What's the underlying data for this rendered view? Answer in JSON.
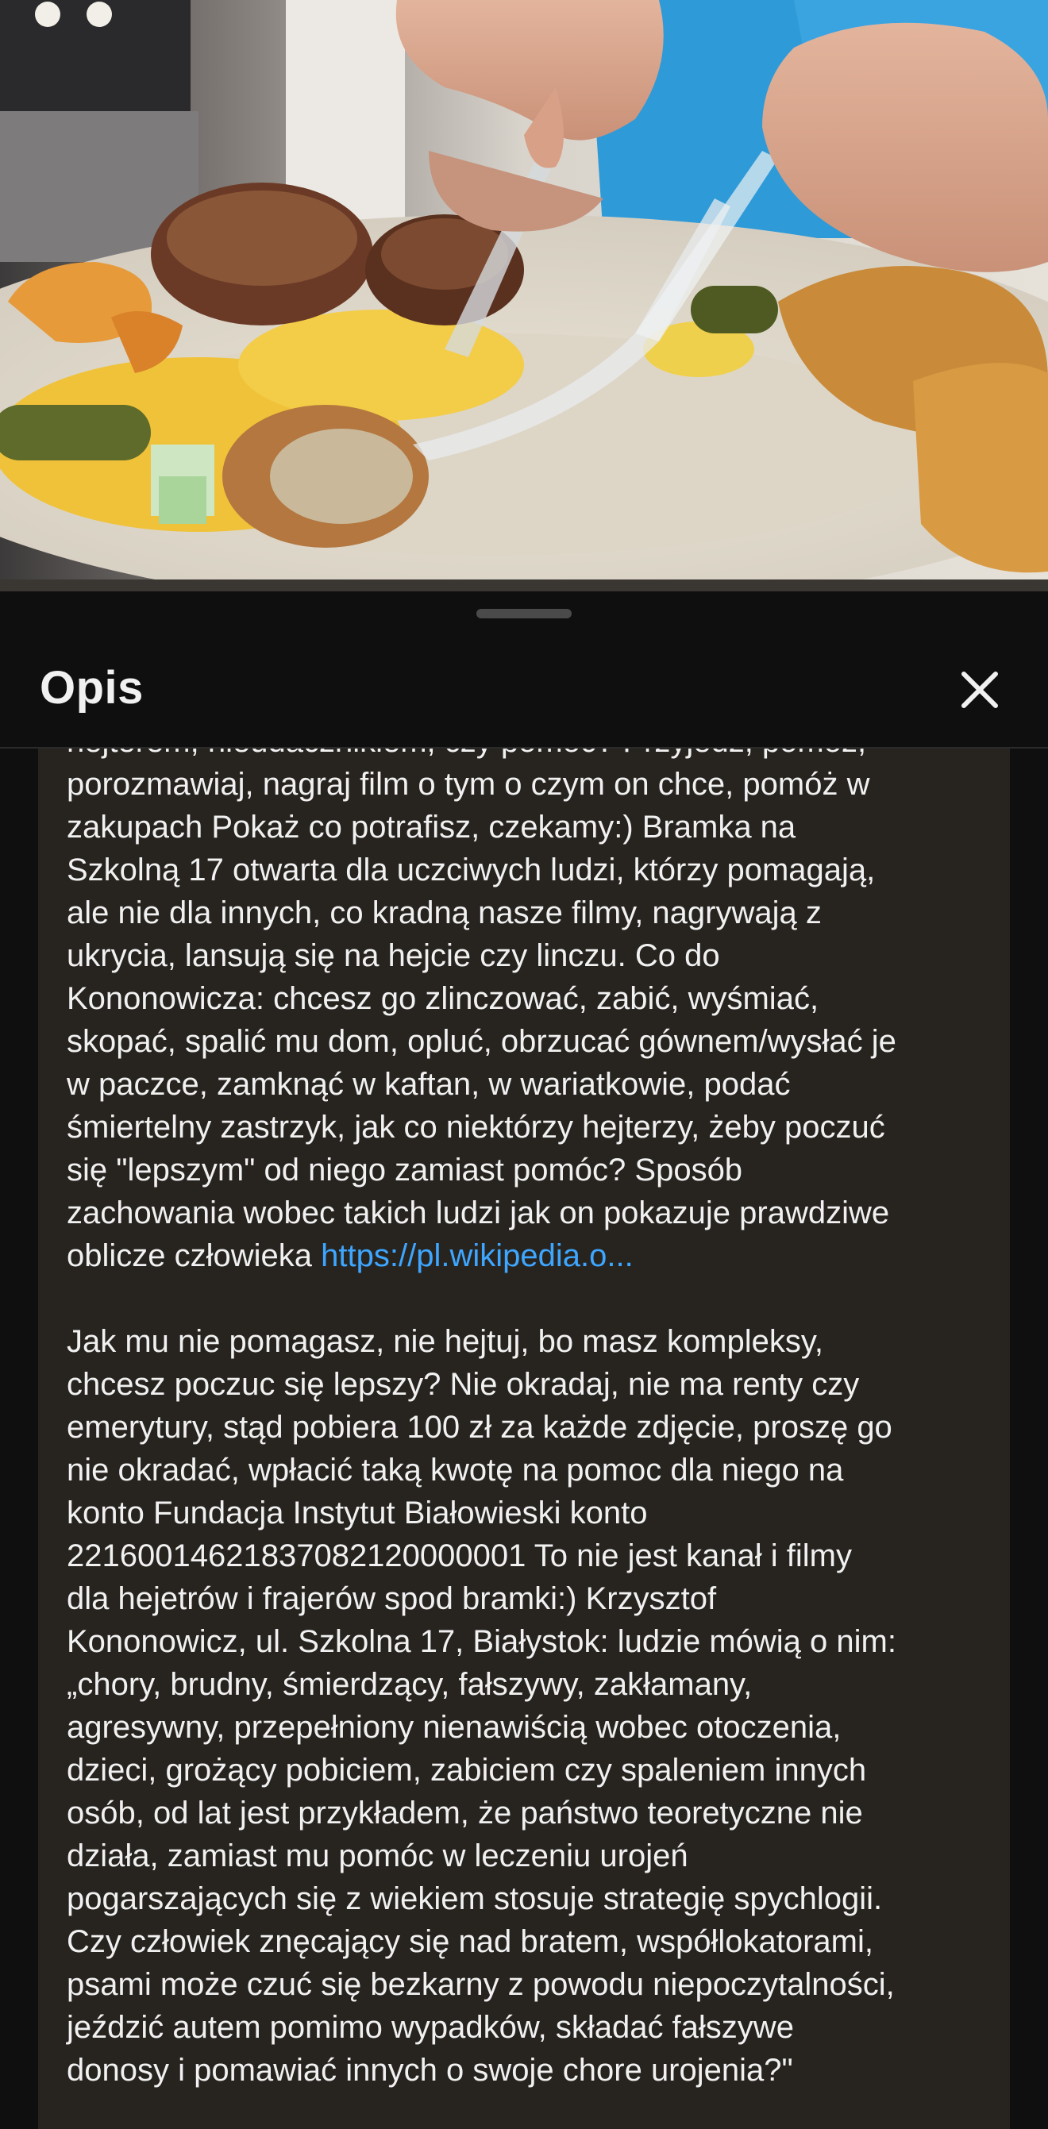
{
  "sheet": {
    "title": "Opis",
    "close_icon": "close-icon"
  },
  "description": {
    "paragraph_1_lines": [
      "hejterem, nieudacznikiem, czy pomoc? Przyjedź, pomóż,",
      "porozmawiaj, nagraj film o tym o czym on chce, pomóż w",
      "zakupach Pokaż co potrafisz, czekamy:) Bramka na",
      "Szkolną 17 otwarta dla uczciwych ludzi, którzy pomagają,",
      "ale nie dla innych, co kradną nasze filmy, nagrywają z",
      "ukrycia, lansują się na hejcie czy linczu. Co do",
      "Kononowicza: chcesz go zlinczować, zabić, wyśmiać,",
      "skopać, spalić mu dom, opluć, obrzucać gównem/wysłać je",
      "w paczce, zamknąć w kaftan, w wariatkowie, podać",
      "śmiertelny zastrzyk, jak co niektórzy hejterzy, żeby poczuć",
      "się \"lepszym\" od niego zamiast pomóc? Sposób",
      "zachowania wobec takich ludzi jak on pokazuje prawdziwe"
    ],
    "paragraph_1_last_text": "oblicze człowieka ",
    "link_text": "https://pl.wikipedia.o...",
    "paragraph_2_lines": [
      "Jak mu nie pomagasz, nie hejtuj, bo masz kompleksy,",
      "chcesz poczuc się lepszy? Nie okradaj, nie ma renty czy",
      "emerytury, stąd pobiera 100 zł za każde zdjęcie, proszę go",
      "nie okradać, wpłacić taką kwotę na pomoc dla niego na",
      "konto Fundacja Instytut Białowieski konto",
      "22160014621837082120000001 To nie jest kanał i filmy",
      "dla hejetrów i frajerów spod bramki:) Krzysztof",
      "Kononowicz, ul. Szkolna 17, Białystok: ludzie mówią o nim:",
      "„chory, brudny, śmierdzący, fałszywy, zakłamany,",
      "agresywny, przepełniony nienawiścią wobec otoczenia,",
      "dzieci, grożący pobiciem, zabiciem czy spaleniem innych",
      "osób, od lat jest przykładem, że państwo teoretyczne nie",
      "działa, zamiast mu pomóc w leczeniu urojeń",
      "pogarszających się z wiekiem stosuje strategię spychlogii.",
      "Czy człowiek znęcający się nad bratem, współlokatorami,",
      "psami może czuć się bezkarny z powodu niepoczytalności,",
      "jeździć autem pomimo wypadków, składać fałszywe",
      "donosy i pomawiać innych o swoje chore urojenia?\""
    ]
  },
  "colors": {
    "sheet_background": "#0f0f0f",
    "description_background": "#272420",
    "link": "#3ea6ff",
    "text": "#f1f1f1"
  }
}
